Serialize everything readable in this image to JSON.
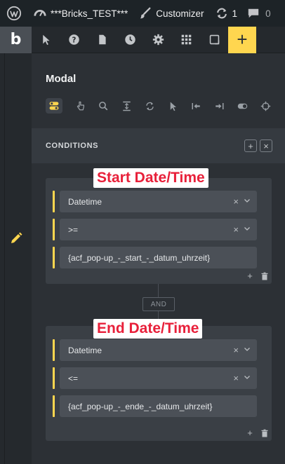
{
  "adminbar": {
    "site_name": "***Bricks_TEST***",
    "customizer_label": "Customizer",
    "updates_count": "1",
    "comments_count": "0"
  },
  "toolbar": {
    "logo": "b",
    "add_label": "+"
  },
  "panel": {
    "title": "Modal",
    "conditions_label": "CONDITIONS",
    "header_add": "+",
    "header_close": "×"
  },
  "groups": [
    {
      "rows": [
        {
          "value": "Datetime"
        },
        {
          "value": ">="
        },
        {
          "value": "{acf_pop-up_-_start_-_datum_uhrzeit}"
        }
      ],
      "add_label": "+"
    },
    {
      "rows": [
        {
          "value": "Datetime"
        },
        {
          "value": "<="
        },
        {
          "value": "{acf_pop-up_-_ende_-_datum_uhrzeit}"
        }
      ],
      "add_label": "+"
    }
  ],
  "and_label": "AND",
  "annotations": {
    "start": "Start Date/Time",
    "end": "End Date/Time"
  },
  "colors": {
    "accent": "#ffd64f",
    "annotation_text": "#e8203a"
  }
}
